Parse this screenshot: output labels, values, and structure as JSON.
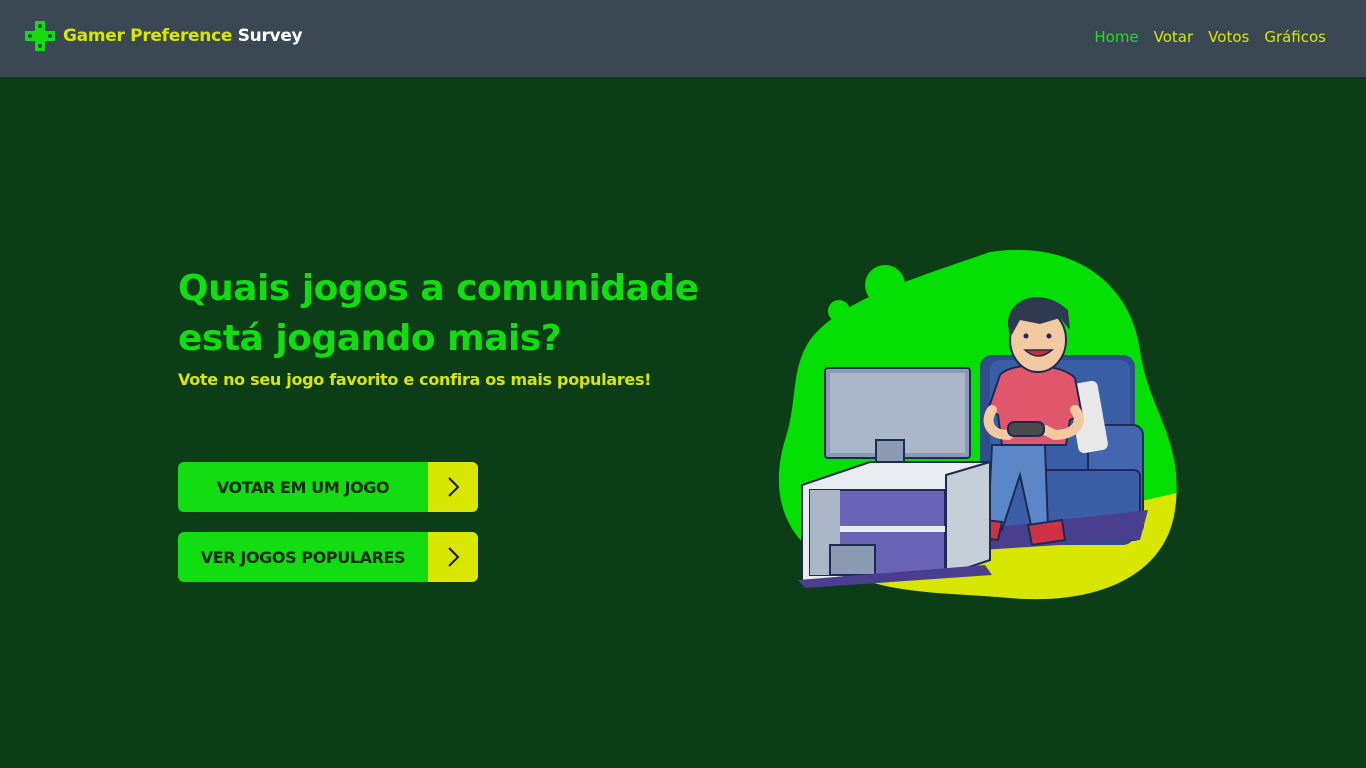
{
  "header": {
    "brand_part1": "Gamer Preference",
    "brand_part2": "Survey",
    "logo_icon": "gamepad-cross-icon",
    "nav": [
      {
        "label": "Home",
        "active": true
      },
      {
        "label": "Votar",
        "active": false
      },
      {
        "label": "Votos",
        "active": false
      },
      {
        "label": "Gráficos",
        "active": false
      }
    ]
  },
  "hero": {
    "headline_line1": "Quais jogos a comunidade",
    "headline_line2": "está jogando mais?",
    "subheadline": "Vote no seu jogo favorito e confira os mais populares!",
    "buttons": [
      {
        "label": "VOTAR EM UM JOGO",
        "icon": "chevron-right-icon"
      },
      {
        "label": "VER JOGOS POPULARES",
        "icon": "chevron-right-icon"
      }
    ]
  },
  "colors": {
    "background": "#0b3d17",
    "header": "#3a4853",
    "accent_green": "#11dd11",
    "accent_yellow": "#d9e600"
  }
}
